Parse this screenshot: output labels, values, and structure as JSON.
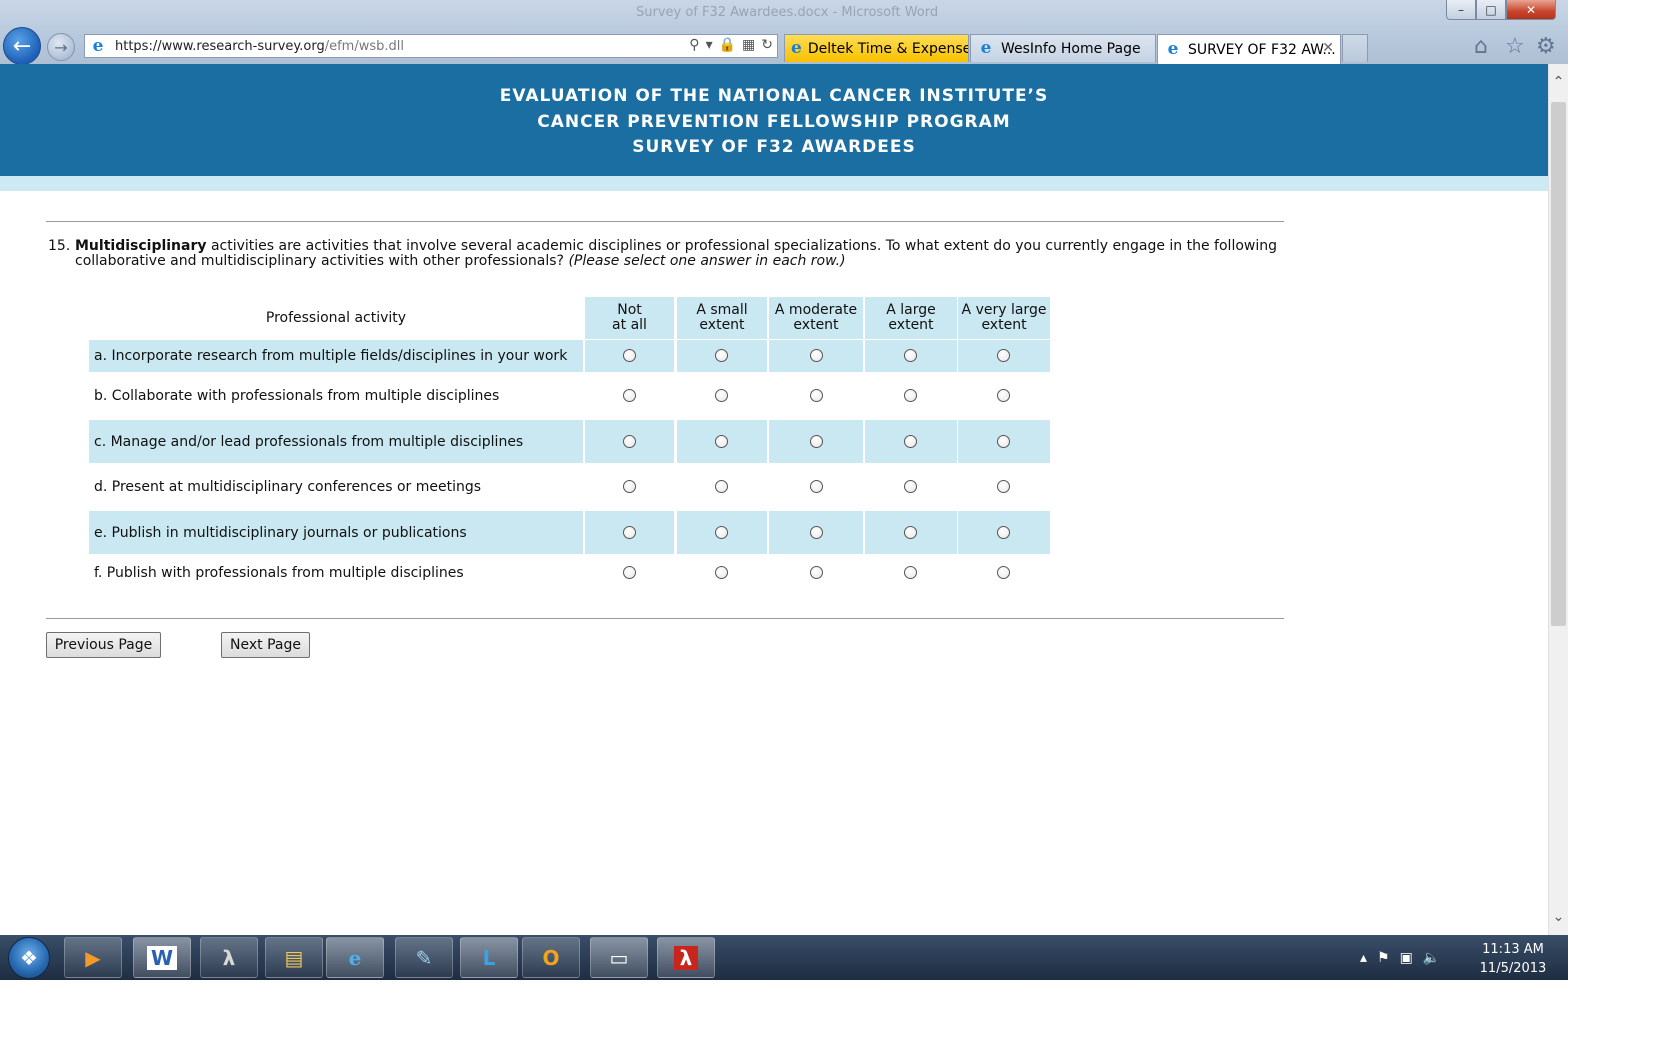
{
  "window": {
    "title": "Survey of F32 Awardees.docx - Microsoft Word",
    "minimize": "–",
    "maximize": "□",
    "close": "✕"
  },
  "browser": {
    "back_icon": "back-arrow-icon",
    "forward_icon": "forward-arrow-icon",
    "url_main": "https://www.research-survey.org",
    "url_path": "/efm/wsb.dll",
    "tabs": [
      {
        "label": "Deltek Time & Expense...",
        "color": "#f7c100"
      },
      {
        "label": "WesInfo Home Page"
      },
      {
        "label": "SURVEY OF F32 AW...",
        "active": true,
        "close": "✕"
      }
    ]
  },
  "header": {
    "line1": "EVALUATION OF THE NATIONAL CANCER INSTITUTE’S",
    "line2": "CANCER PREVENTION FELLOWSHIP PROGRAM",
    "line3": "SURVEY OF F32 AWARDEES",
    "banner_color": "#1b6ea2",
    "band_color": "#cdeaf4"
  },
  "question": {
    "number": "15.",
    "bold_term": "Multidisciplinary",
    "text": " activities are activities that involve several academic disciplines or professional specializations. To what extent do you currently engage in the following collaborative and multidisciplinary activities with other professionals? ",
    "instruction": "(Please select one answer in each row.)"
  },
  "grid": {
    "activity_header": "Professional activity",
    "columns": [
      {
        "line1": "Not",
        "line2": "at all"
      },
      {
        "line1": "A small",
        "line2": "extent"
      },
      {
        "line1": "A moderate",
        "line2": "extent"
      },
      {
        "line1": "A large",
        "line2": "extent"
      },
      {
        "line1": "A very large",
        "line2": "extent"
      }
    ],
    "rows": [
      {
        "label": "a. Incorporate research from multiple fields/disciplines in your work"
      },
      {
        "label": "b. Collaborate with professionals from multiple disciplines"
      },
      {
        "label": "c. Manage and/or lead professionals from multiple disciplines"
      },
      {
        "label": "d. Present at multidisciplinary conferences or meetings"
      },
      {
        "label": "e. Publish in multidisciplinary journals or publications"
      },
      {
        "label": "f. Publish with professionals from multiple disciplines"
      }
    ],
    "shade_color": "#c9e8f2"
  },
  "navigation": {
    "previous": "Previous Page",
    "next": "Next Page"
  },
  "taskbar": {
    "apps": [
      "media-player",
      "word",
      "acrobat",
      "file-explorer",
      "internet-explorer",
      "notepad",
      "lync",
      "outlook",
      "blank-document",
      "adobe-reader"
    ],
    "time": "11:13 AM",
    "date": "11/5/2013"
  }
}
